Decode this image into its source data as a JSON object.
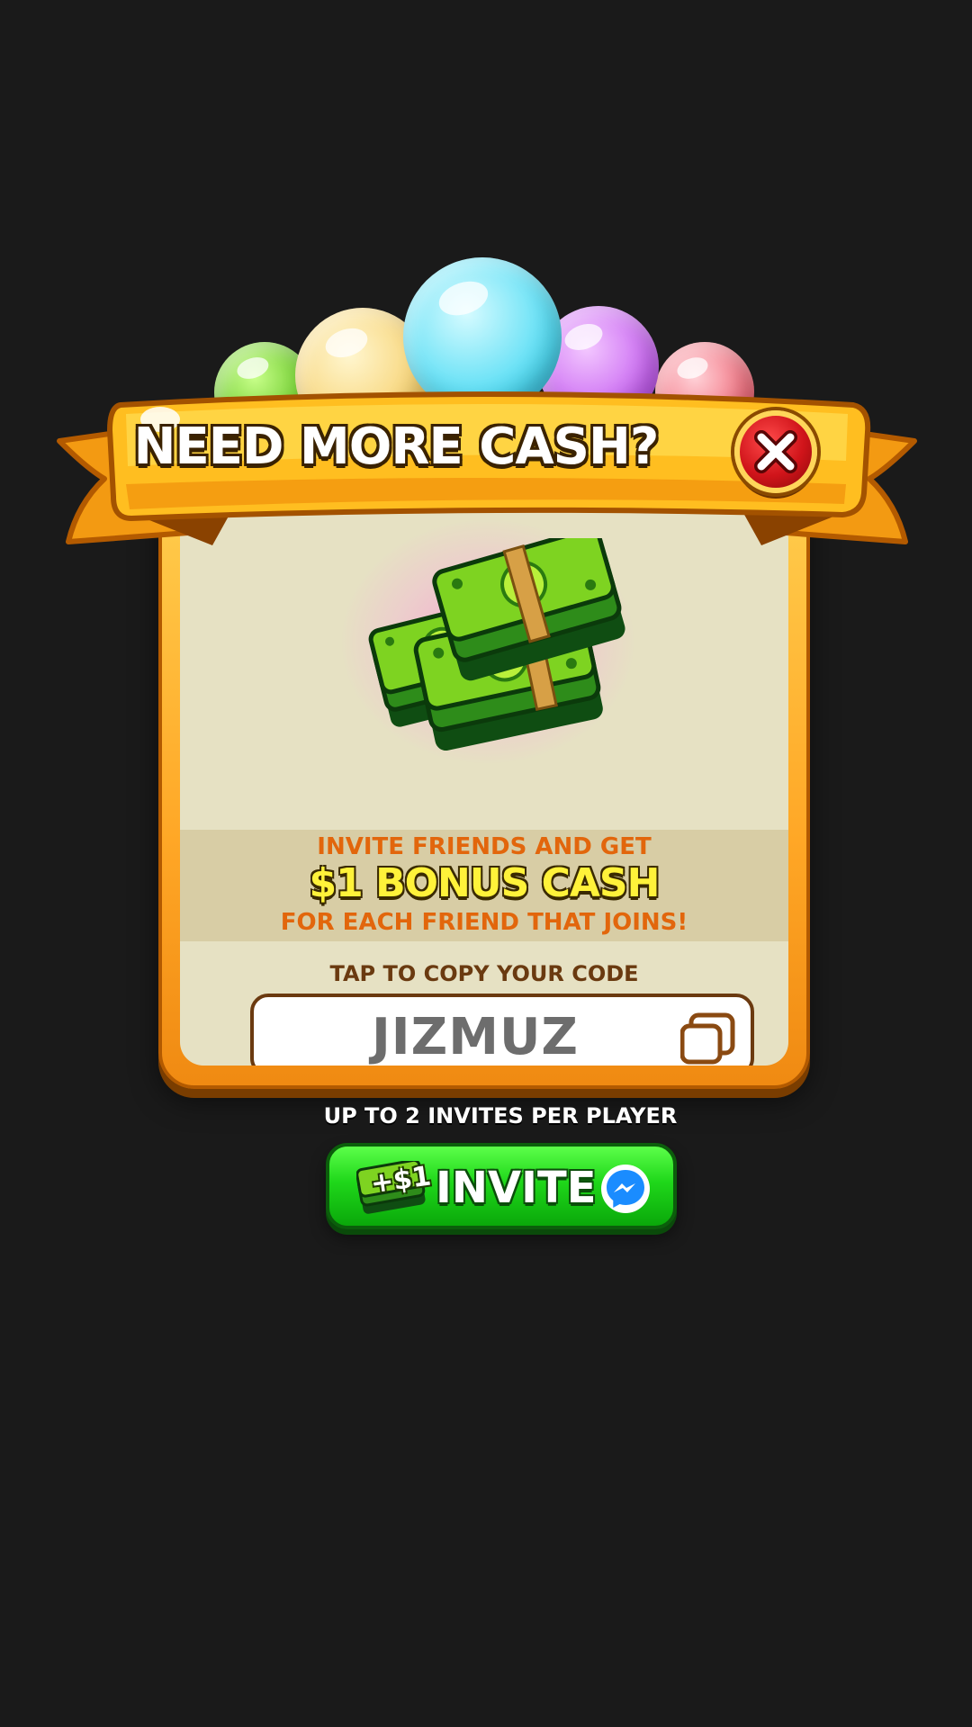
{
  "banner": {
    "title": "NEED MORE CASH?"
  },
  "promo": {
    "line1": "INVITE FRIENDS AND GET",
    "line2": "$1 BONUS CASH",
    "line3": "FOR EACH FRIEND THAT JOINS!"
  },
  "code_section": {
    "label": "TAP TO COPY YOUR CODE",
    "code": "JIZMUZ"
  },
  "footer": {
    "limit_text": "UP TO 2 INVITES PER PLAYER",
    "invite_label": "INVITE",
    "invite_badge": "+$1"
  },
  "icons": {
    "close": "close-icon",
    "copy": "copy-icon",
    "cash": "cash-stack-icon",
    "messenger": "messenger-icon"
  },
  "colors": {
    "background": "#1a1a1a",
    "banner": "#ffb81c",
    "card_border": "#ffa726",
    "card_fill": "#e6e1c3",
    "promo_orange": "#e2660c",
    "promo_yellow": "#fff23a",
    "invite_green": "#1fd71a",
    "close_red": "#d0141a",
    "messenger_blue": "#1a8cff"
  }
}
